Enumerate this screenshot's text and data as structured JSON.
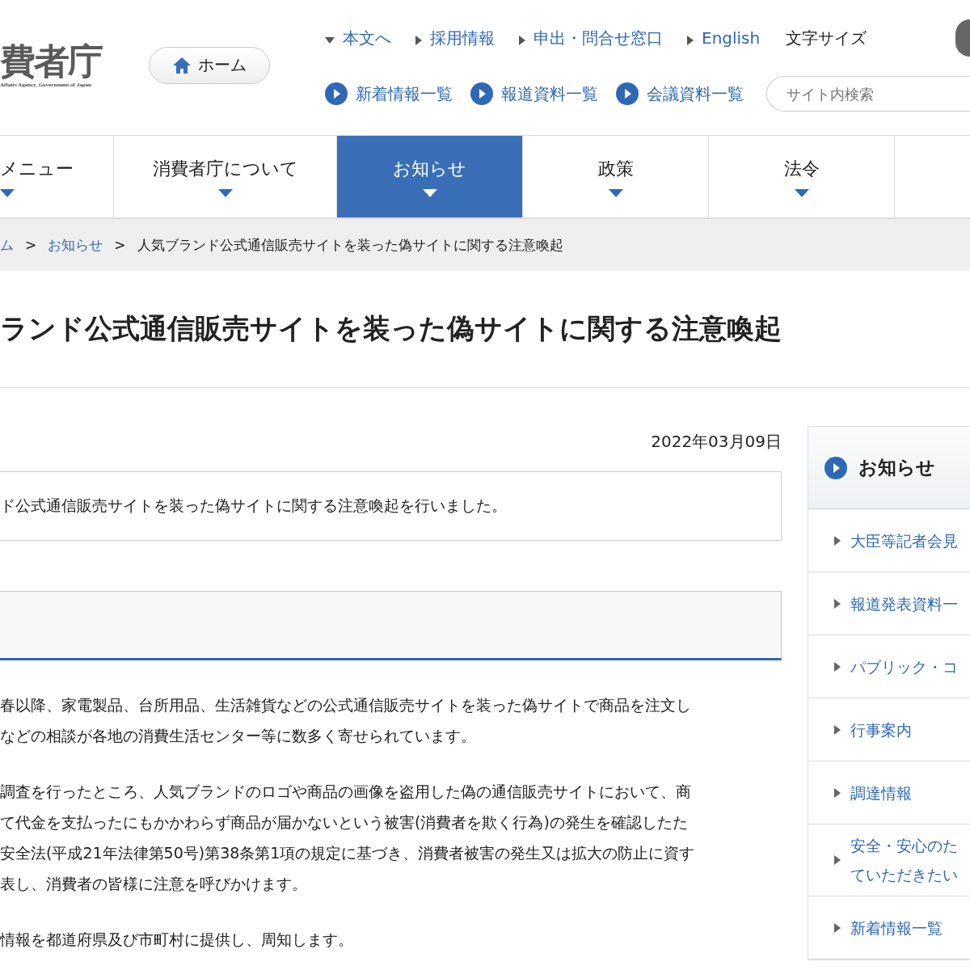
{
  "header": {
    "logo": {
      "name": "費者庁",
      "subtitle": "Affairs Agency, Government of Japan"
    },
    "home_button": "ホーム",
    "top_links": [
      {
        "label": "本文へ",
        "kind": "down"
      },
      {
        "label": "採用情報",
        "kind": "right"
      },
      {
        "label": "申出・問合せ窓口",
        "kind": "right"
      },
      {
        "label": "English",
        "kind": "right"
      }
    ],
    "font_size_label": "文字サイズ",
    "quick_links": [
      "新着情報一覧",
      "報道資料一覧",
      "会議資料一覧"
    ],
    "search": {
      "placeholder": "サイト内検索"
    }
  },
  "nav": [
    {
      "label": "メニュー",
      "selected": false
    },
    {
      "label": "消費者庁について",
      "selected": false
    },
    {
      "label": "お知らせ",
      "selected": true
    },
    {
      "label": "政策",
      "selected": false
    },
    {
      "label": "法令",
      "selected": false
    }
  ],
  "breadcrumb": {
    "separator": ">",
    "items": [
      {
        "label": "ム",
        "kind": "link"
      },
      {
        "label": "お知らせ",
        "kind": "link"
      },
      {
        "label": "人気ブランド公式通信販売サイトを装った偽サイトに関する注意喚起",
        "kind": "current"
      }
    ]
  },
  "article": {
    "title": "ランド公式通信販売サイトを装った偽サイトに関する注意喚起",
    "date": "2022年03月09日",
    "summary": "ド公式通信販売サイトを装った偽サイトに関する注意喚起を行いました。",
    "paragraphs": [
      [
        "春以降、家電製品、台所用品、生活雑貨などの公式通信販売サイトを装った偽サイトで商品を注文し",
        "などの相談が各地の消費生活センター等に数多く寄せられています。"
      ],
      [
        "調査を行ったところ、人気ブランドのロゴや商品の画像を盗用した偽の通信販売サイトにおいて、商",
        "て代金を支払ったにもかかわらず商品が届かないという被害(消費者を欺く行為)の発生を確認したた",
        "安全法(平成21年法律第50号)第38条第1項の規定に基づき、消費者被害の発生又は拡大の防止に資す",
        "表し、消費者の皆様に注意を呼びかけます。"
      ],
      [
        "情報を都道府県及び市町村に提供し、周知します。"
      ]
    ]
  },
  "sidebar": {
    "heading": "お知らせ",
    "items": [
      [
        "大臣等記者会見"
      ],
      [
        "報道発表資料一"
      ],
      [
        "パブリック・コ"
      ],
      [
        "行事案内"
      ],
      [
        "調達情報"
      ],
      [
        "安全・安心のた",
        "ていただきたい"
      ],
      [
        "新着情報一覧"
      ]
    ]
  }
}
